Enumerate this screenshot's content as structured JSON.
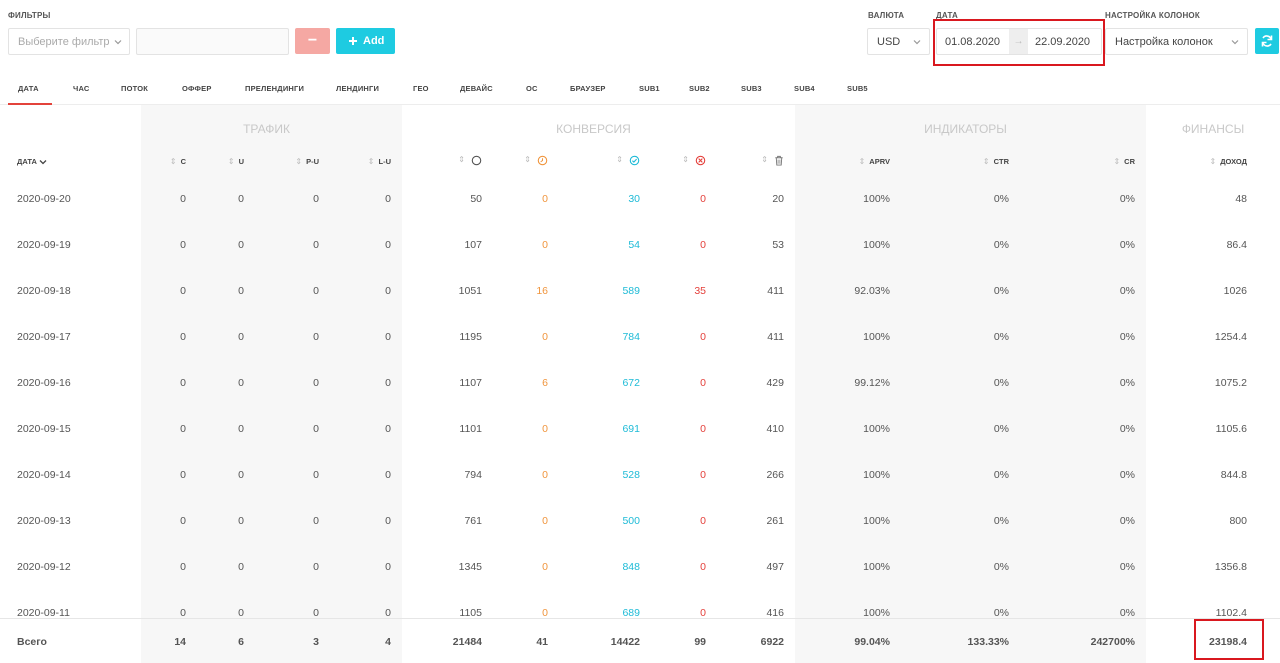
{
  "top": {
    "filters_label": "ФИЛЬТРЫ",
    "filter_placeholder": "Выберите фильтр",
    "minus_label": "−",
    "add_label": "Add",
    "currency_label": "ВАЛЮТА",
    "currency_value": "USD",
    "date_label": "ДАТА",
    "date_from": "01.08.2020",
    "date_arrow": "→",
    "date_to": "22.09.2020",
    "columns_label": "НАСТРОЙКА КОЛОНОК",
    "columns_value": "Настройка колонок",
    "refresh_icon": "refresh-icon",
    "colors": {
      "add": "#1ecbe1",
      "minus": "#f5a8a3",
      "refresh": "#1ecbe1"
    }
  },
  "tabs": [
    "ДАТА",
    "ЧАС",
    "ПОТОК",
    "ОФФЕР",
    "ПРЕЛЕНДИНГИ",
    "ЛЕНДИНГИ",
    "ГЕО",
    "ДЕВАЙС",
    "ОС",
    "БРАУЗЕР",
    "SUB1",
    "SUB2",
    "SUB3",
    "SUB4",
    "SUB5"
  ],
  "groups": {
    "traffic": "ТРАФИК",
    "conversion": "КОНВЕРСИЯ",
    "indicators": "ИНДИКАТОРЫ",
    "finance": "ФИНАНСЫ"
  },
  "headers": {
    "date": "ДАТА",
    "c": "C",
    "u": "U",
    "pu": "P-U",
    "lu": "L-U",
    "aprv": "APRV",
    "ctr": "CTR",
    "cr": "CR",
    "income": "ДОХОД"
  },
  "rows": [
    {
      "date": "2020-09-20",
      "c": "0",
      "u": "0",
      "pu": "0",
      "lu": "0",
      "all": "50",
      "hold": "0",
      "appr": "30",
      "rej": "0",
      "trash": "20",
      "aprv": "100%",
      "ctr": "0%",
      "cr": "0%",
      "income": "48"
    },
    {
      "date": "2020-09-19",
      "c": "0",
      "u": "0",
      "pu": "0",
      "lu": "0",
      "all": "107",
      "hold": "0",
      "appr": "54",
      "rej": "0",
      "trash": "53",
      "aprv": "100%",
      "ctr": "0%",
      "cr": "0%",
      "income": "86.4"
    },
    {
      "date": "2020-09-18",
      "c": "0",
      "u": "0",
      "pu": "0",
      "lu": "0",
      "all": "1051",
      "hold": "16",
      "appr": "589",
      "rej": "35",
      "trash": "411",
      "aprv": "92.03%",
      "ctr": "0%",
      "cr": "0%",
      "income": "1026"
    },
    {
      "date": "2020-09-17",
      "c": "0",
      "u": "0",
      "pu": "0",
      "lu": "0",
      "all": "1195",
      "hold": "0",
      "appr": "784",
      "rej": "0",
      "trash": "411",
      "aprv": "100%",
      "ctr": "0%",
      "cr": "0%",
      "income": "1254.4"
    },
    {
      "date": "2020-09-16",
      "c": "0",
      "u": "0",
      "pu": "0",
      "lu": "0",
      "all": "1107",
      "hold": "6",
      "appr": "672",
      "rej": "0",
      "trash": "429",
      "aprv": "99.12%",
      "ctr": "0%",
      "cr": "0%",
      "income": "1075.2"
    },
    {
      "date": "2020-09-15",
      "c": "0",
      "u": "0",
      "pu": "0",
      "lu": "0",
      "all": "1101",
      "hold": "0",
      "appr": "691",
      "rej": "0",
      "trash": "410",
      "aprv": "100%",
      "ctr": "0%",
      "cr": "0%",
      "income": "1105.6"
    },
    {
      "date": "2020-09-14",
      "c": "0",
      "u": "0",
      "pu": "0",
      "lu": "0",
      "all": "794",
      "hold": "0",
      "appr": "528",
      "rej": "0",
      "trash": "266",
      "aprv": "100%",
      "ctr": "0%",
      "cr": "0%",
      "income": "844.8"
    },
    {
      "date": "2020-09-13",
      "c": "0",
      "u": "0",
      "pu": "0",
      "lu": "0",
      "all": "761",
      "hold": "0",
      "appr": "500",
      "rej": "0",
      "trash": "261",
      "aprv": "100%",
      "ctr": "0%",
      "cr": "0%",
      "income": "800"
    },
    {
      "date": "2020-09-12",
      "c": "0",
      "u": "0",
      "pu": "0",
      "lu": "0",
      "all": "1345",
      "hold": "0",
      "appr": "848",
      "rej": "0",
      "trash": "497",
      "aprv": "100%",
      "ctr": "0%",
      "cr": "0%",
      "income": "1356.8"
    },
    {
      "date": "2020-09-11",
      "c": "0",
      "u": "0",
      "pu": "0",
      "lu": "0",
      "all": "1105",
      "hold": "0",
      "appr": "689",
      "rej": "0",
      "trash": "416",
      "aprv": "100%",
      "ctr": "0%",
      "cr": "0%",
      "income": "1102.4"
    }
  ],
  "totals": {
    "date": "Всего",
    "c": "14",
    "u": "6",
    "pu": "3",
    "lu": "4",
    "all": "21484",
    "hold": "41",
    "appr": "14422",
    "rej": "99",
    "trash": "6922",
    "aprv": "99.04%",
    "ctr": "133.33%",
    "cr": "242700%",
    "income": "23198.4"
  }
}
